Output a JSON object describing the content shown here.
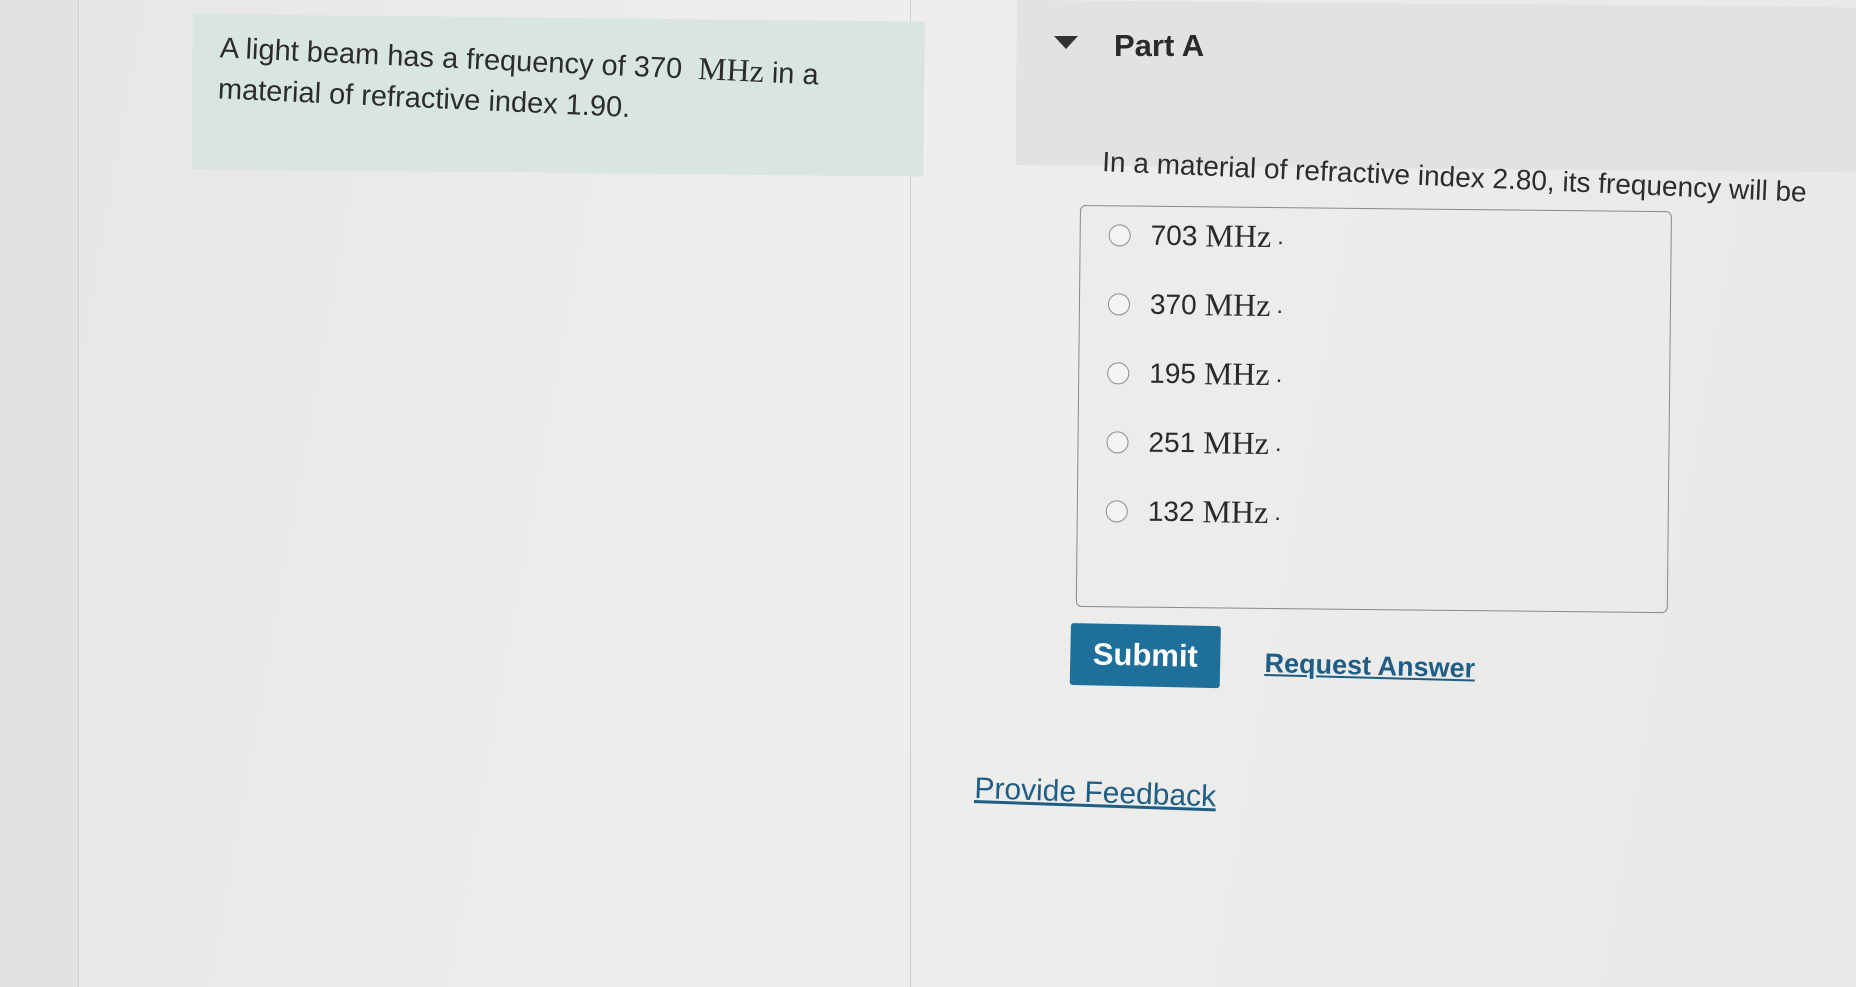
{
  "problem": {
    "text_before": "A light beam has a frequency of 370",
    "unit": "MHz",
    "text_after": "in a material of refractive index 1.90."
  },
  "part": {
    "title": "Part A",
    "question": "In a material of refractive index 2.80, its frequency will be"
  },
  "choices": [
    {
      "value": "703",
      "unit": "MHz",
      "suffix": "."
    },
    {
      "value": "370",
      "unit": "MHz",
      "suffix": "."
    },
    {
      "value": "195",
      "unit": "MHz",
      "suffix": "."
    },
    {
      "value": "251",
      "unit": "MHz",
      "suffix": "."
    },
    {
      "value": "132",
      "unit": "MHz",
      "suffix": "."
    }
  ],
  "actions": {
    "submit_label": "Submit",
    "request_answer_label": "Request Answer",
    "feedback_label": "Provide Feedback"
  },
  "colors": {
    "submit_bg": "#1f6f9b",
    "link": "#1e5d85",
    "problem_bg": "#d9e5e3"
  },
  "icons": {
    "collapse": "triangle-down-icon"
  }
}
